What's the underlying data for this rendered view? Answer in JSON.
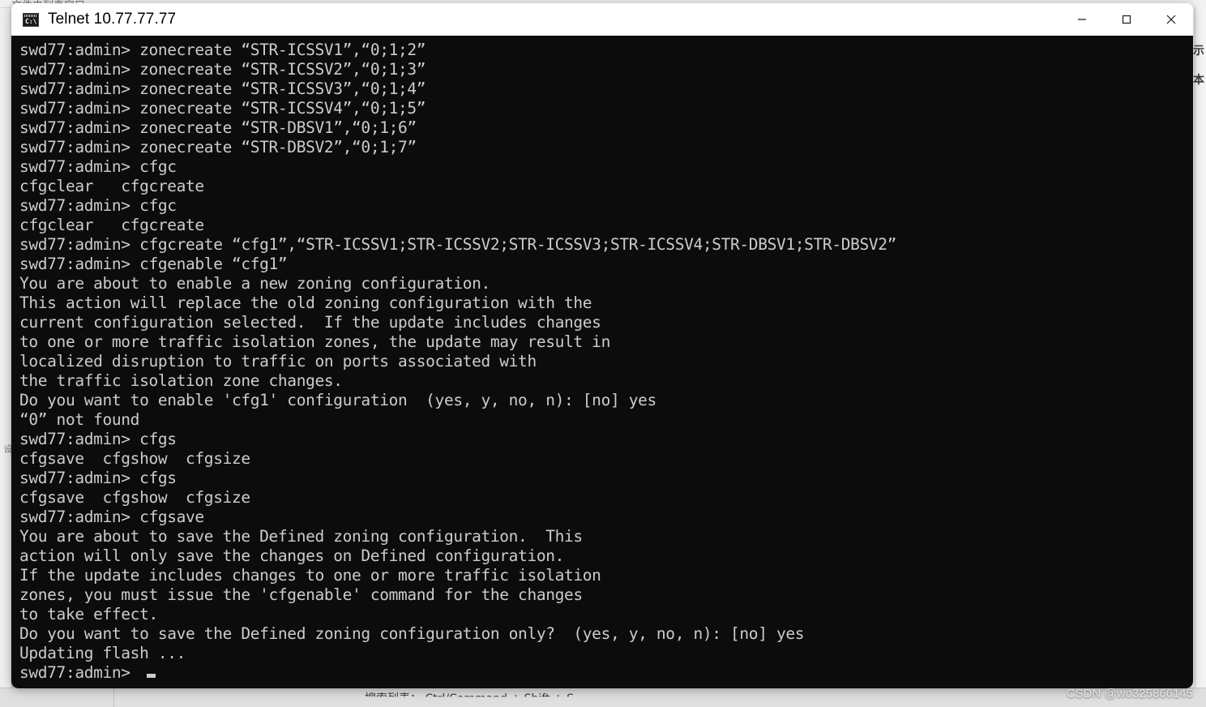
{
  "window": {
    "title": "Telnet 10.77.77.77",
    "icon": "console-icon",
    "controls": {
      "minimize": "—",
      "maximize": "□",
      "close": "✕"
    }
  },
  "terminal": {
    "prompt": "swd77:admin>",
    "cursor": "block",
    "lines": [
      "swd77:admin> zonecreate “STR-ICSSV1”,“0;1;2”",
      "swd77:admin> zonecreate “STR-ICSSV2”,“0;1;3”",
      "swd77:admin> zonecreate “STR-ICSSV3”,“0;1;4”",
      "swd77:admin> zonecreate “STR-ICSSV4”,“0;1;5”",
      "swd77:admin> zonecreate “STR-DBSV1”,“0;1;6”",
      "swd77:admin> zonecreate “STR-DBSV2”,“0;1;7”",
      "swd77:admin> cfgc",
      "cfgclear   cfgcreate",
      "swd77:admin> cfgc",
      "cfgclear   cfgcreate",
      "swd77:admin> cfgcreate “cfg1”,“STR-ICSSV1;STR-ICSSV2;STR-ICSSV3;STR-ICSSV4;STR-DBSV1;STR-DBSV2”",
      "swd77:admin> cfgenable “cfg1”",
      "You are about to enable a new zoning configuration.",
      "This action will replace the old zoning configuration with the",
      "current configuration selected.  If the update includes changes",
      "to one or more traffic isolation zones, the update may result in",
      "localized disruption to traffic on ports associated with",
      "the traffic isolation zone changes.",
      "Do you want to enable 'cfg1' configuration  (yes, y, no, n): [no] yes",
      "“0” not found",
      "swd77:admin> cfgs",
      "cfgsave  cfgshow  cfgsize",
      "swd77:admin> cfgs",
      "cfgsave  cfgshow  cfgsize",
      "swd77:admin> cfgsave",
      "You are about to save the Defined zoning configuration.  This",
      "action will only save the changes on Defined configuration.",
      "If the update includes changes to one or more traffic isolation",
      "zones, you must issue the 'cfgenable' command for the changes",
      "to take effect.",
      "Do you want to save the Defined zoning configuration only?  (yes, y, no, n): [no] yes",
      "Updating flash ...",
      "swd77:admin> "
    ]
  },
  "background": {
    "top_text": "文件夹列表窗口",
    "bottom_text": "搜索列表：   Ctrl/Command  +  Shift  +  S",
    "cjk_labels": [
      "示",
      "本"
    ],
    "left_label": "设"
  },
  "watermark": {
    "text": "CSDN @wo325866145"
  }
}
